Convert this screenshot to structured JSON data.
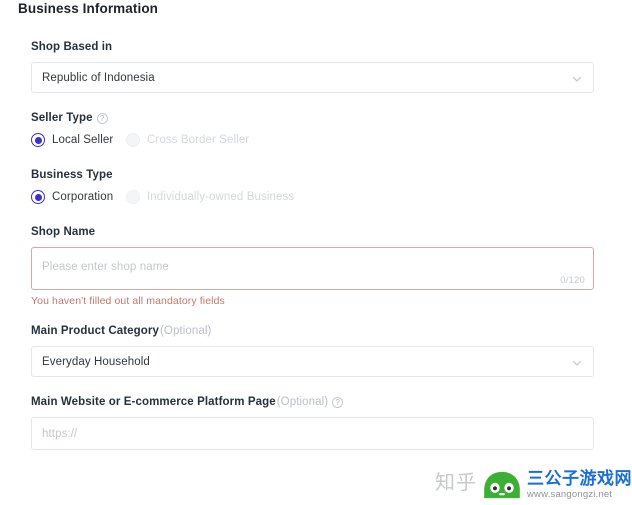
{
  "page": {
    "title": "Business Information"
  },
  "fields": {
    "shop_based_in": {
      "label": "Shop Based in",
      "value": "Republic of Indonesia",
      "icon": "chevron-down-icon"
    },
    "seller_type": {
      "label": "Seller Type",
      "help_icon": "question-circle-icon",
      "help_glyph": "?",
      "options": [
        {
          "label": "Local Seller",
          "selected": true,
          "disabled": false
        },
        {
          "label": "Cross Border Seller",
          "selected": false,
          "disabled": true
        }
      ]
    },
    "business_type": {
      "label": "Business Type",
      "options": [
        {
          "label": "Corporation",
          "selected": true,
          "disabled": false
        },
        {
          "label": "Individually-owned Business",
          "selected": false,
          "disabled": true
        }
      ]
    },
    "shop_name": {
      "label": "Shop Name",
      "placeholder": "Please enter shop name",
      "value": "",
      "counter": "0/120",
      "error": "You haven't filled out all mandatory fields",
      "error_color": "#c9756b",
      "border_color": "#e0a59c"
    },
    "main_product_category": {
      "label": "Main Product Category",
      "optional": "(Optional)",
      "value": "Everyday Household",
      "icon": "chevron-down-icon"
    },
    "main_website": {
      "label": "Main Website or E-commerce Platform Page",
      "optional": "(Optional)",
      "help_icon": "question-circle-icon",
      "help_glyph": "?",
      "placeholder": "https://",
      "value": ""
    }
  },
  "watermark": {
    "zhihu": "知乎",
    "logo_icon": "frog-logo-icon",
    "site_name": "三公子游戏网",
    "site_url": "www.sangongzi.net",
    "logo_color": "#3cb034",
    "title_color": "#1a6fd4"
  },
  "theme": {
    "accent": "#3b33c9",
    "text": "#31383f",
    "label": "#26313c",
    "muted": "#c3c8ce",
    "border": "#e3e6ea"
  }
}
